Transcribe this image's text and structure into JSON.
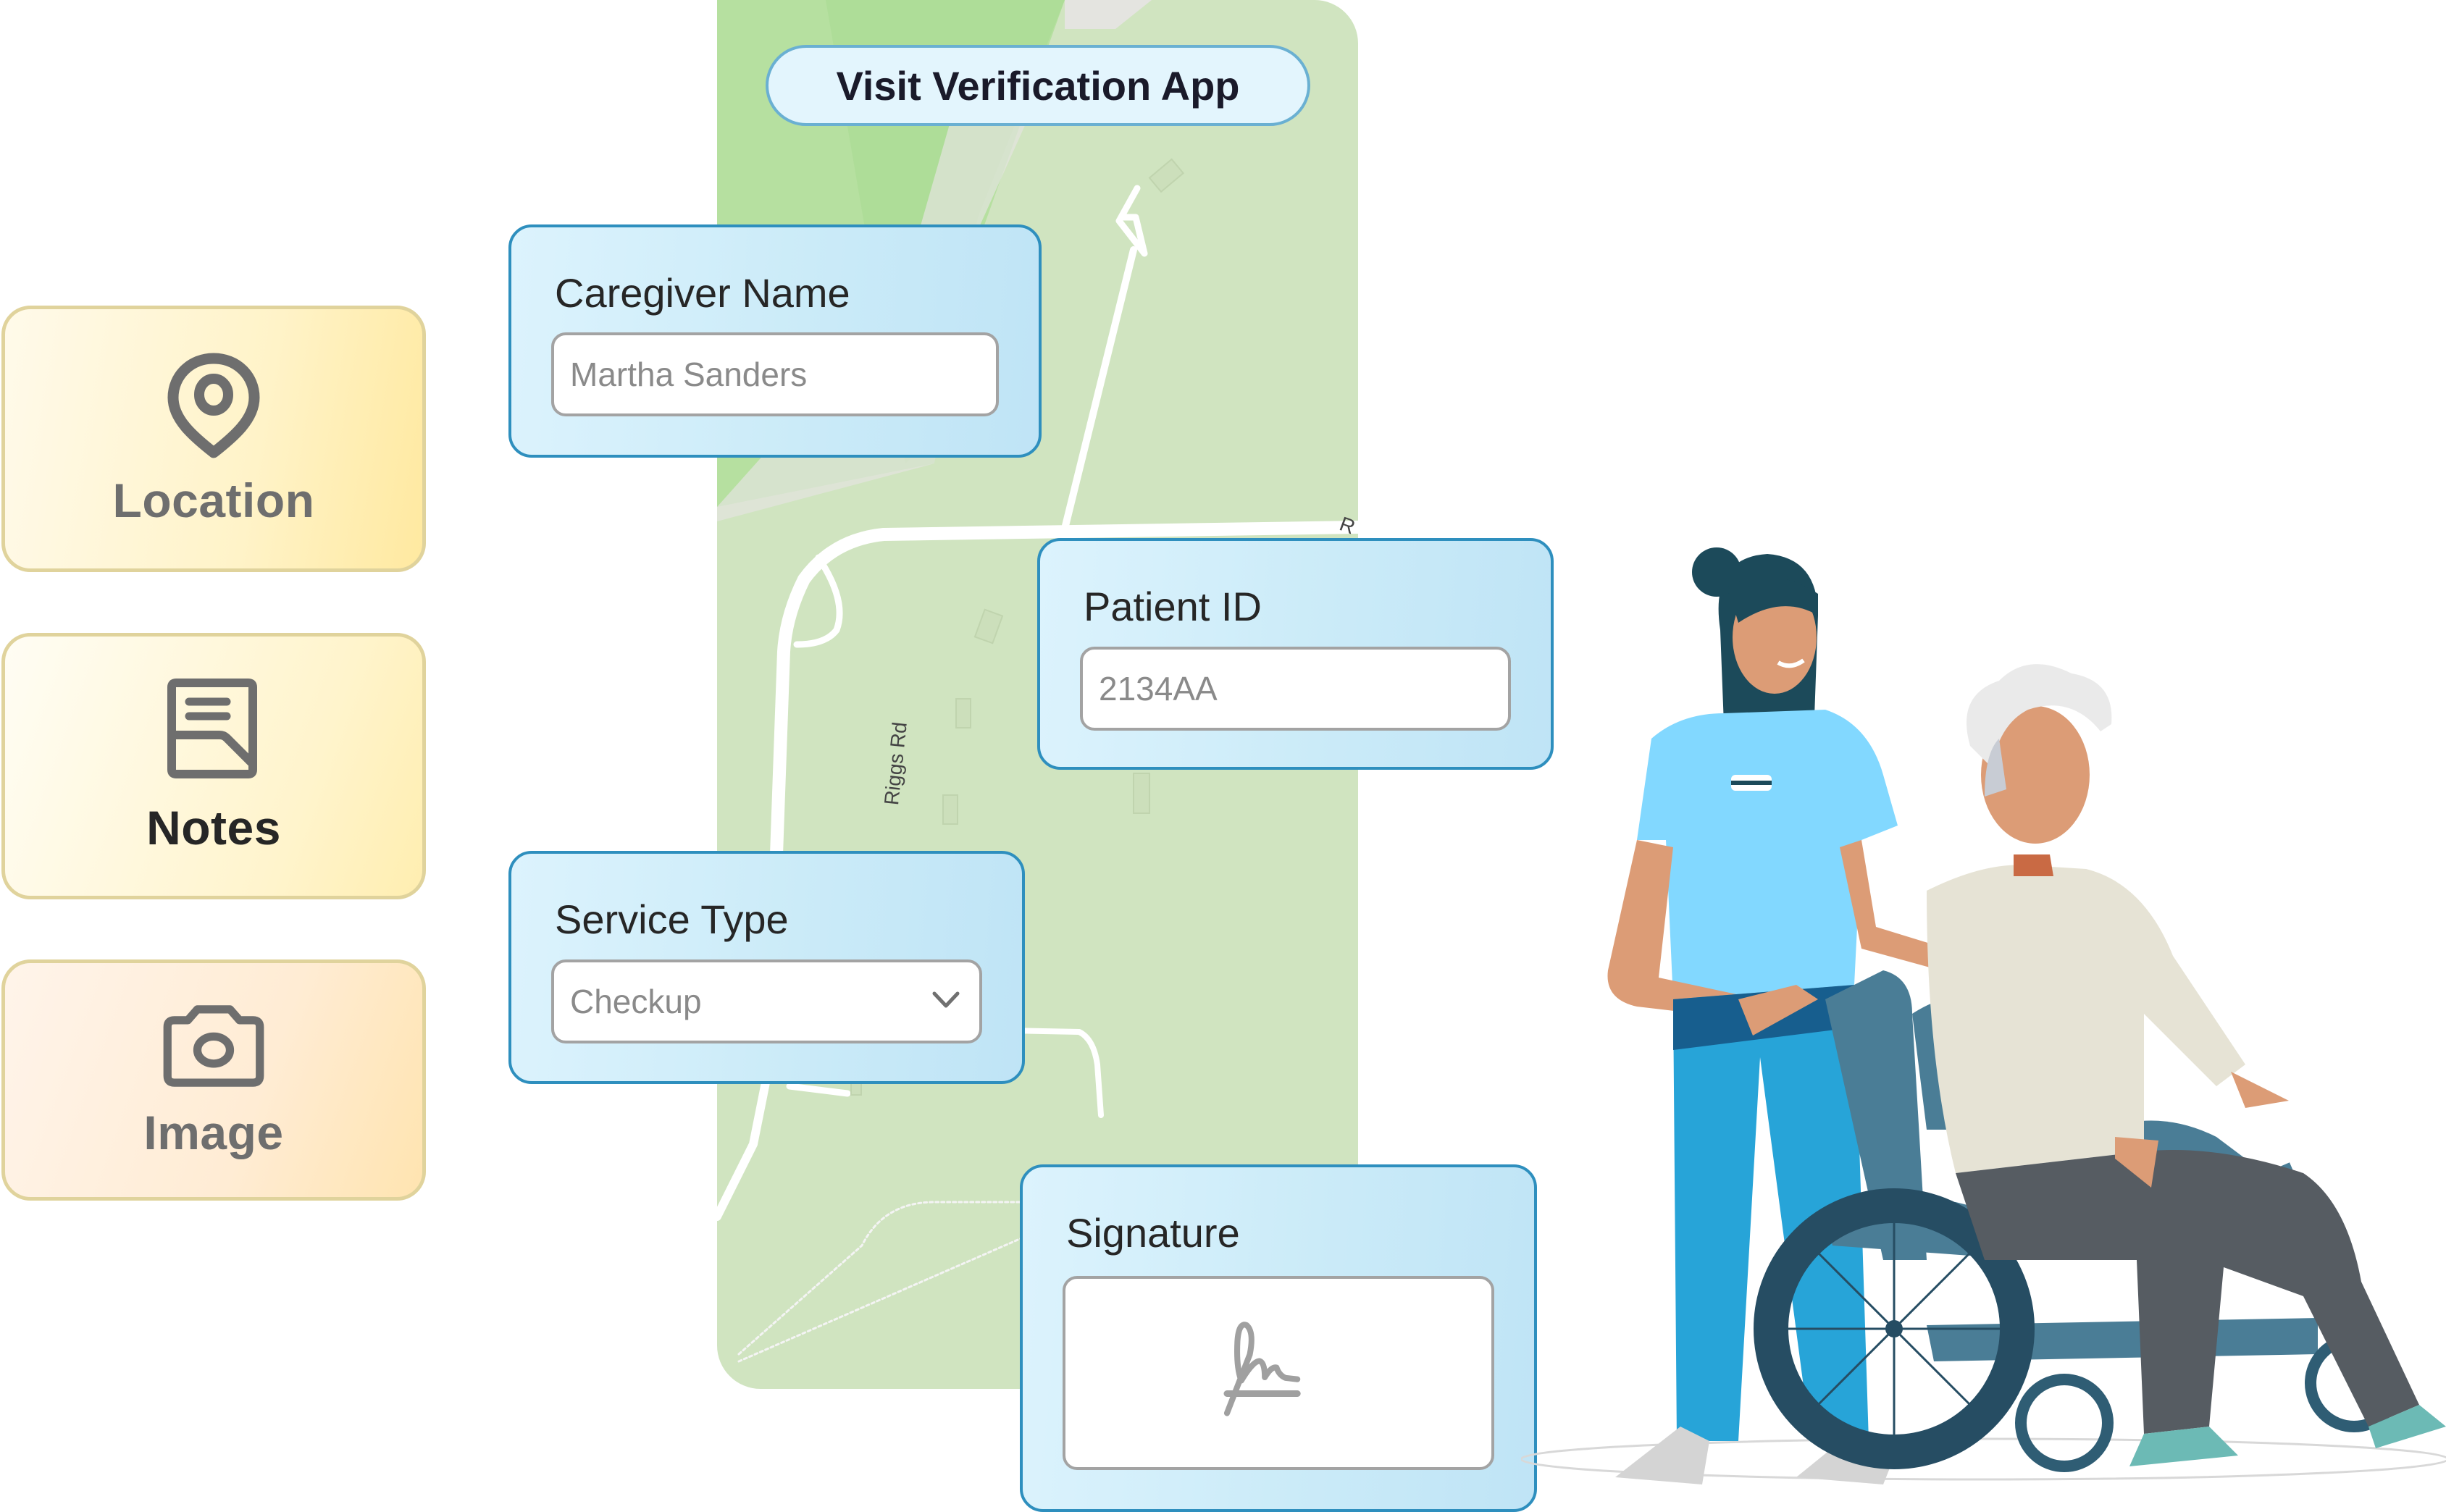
{
  "app": {
    "title": "Visit Verification App"
  },
  "features": [
    {
      "label": "Location",
      "icon": "map-pin-icon"
    },
    {
      "label": "Notes",
      "icon": "note-icon"
    },
    {
      "label": "Image",
      "icon": "camera-icon"
    }
  ],
  "map": {
    "road_labels": [
      "Riggs Rd",
      "R"
    ]
  },
  "form": {
    "caregiver": {
      "label": "Caregiver Name",
      "value": "Martha Sanders"
    },
    "patient": {
      "label": "Patient ID",
      "value": "2134AA"
    },
    "service": {
      "label": "Service Type",
      "value": "Checkup",
      "icon": "chevron-down-icon"
    },
    "signature": {
      "label": "Signature",
      "icon": "signature-icon"
    }
  },
  "illustration": {
    "description": "Caregiver pushing elderly woman in wheelchair"
  },
  "colors": {
    "card_border": "#2e8fbe",
    "feature_border": "#e0d39c",
    "map_green": "#d0e4c0",
    "icon_gray": "#6e6e6e"
  }
}
